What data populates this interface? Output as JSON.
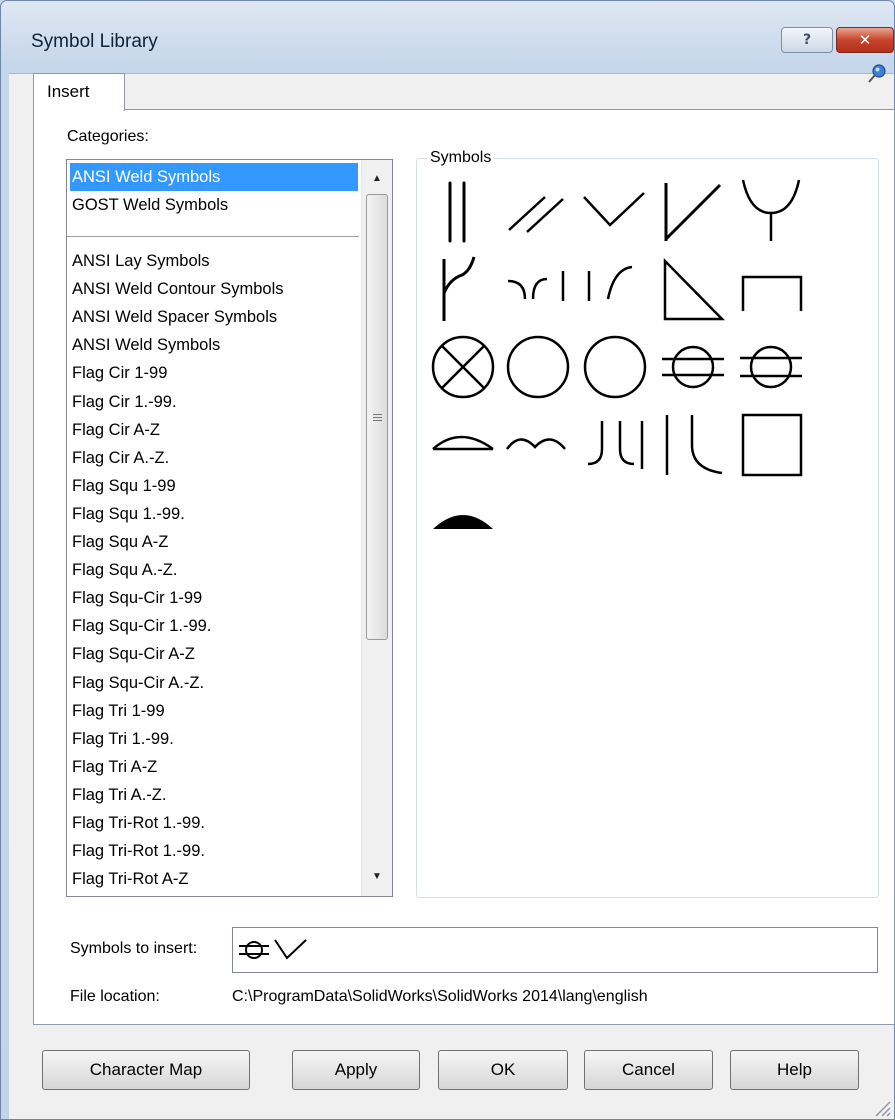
{
  "window": {
    "title": "Symbol Library",
    "help_glyph": "?",
    "close_glyph": "✕"
  },
  "tabs": [
    {
      "label": "Insert",
      "active": true
    }
  ],
  "categories": {
    "label": "Categories:",
    "top_items": [
      {
        "label": "ANSI Weld Symbols",
        "selected": true
      },
      {
        "label": "GOST Weld Symbols",
        "selected": false
      }
    ],
    "items": [
      "ANSI Lay Symbols",
      "ANSI Weld Contour Symbols",
      "ANSI Weld Spacer Symbols",
      "ANSI Weld Symbols",
      "Flag Cir 1-99",
      "Flag Cir 1.-99.",
      "Flag Cir A-Z",
      "Flag Cir A.-Z.",
      "Flag Squ 1-99",
      "Flag Squ 1.-99.",
      "Flag Squ A-Z",
      "Flag Squ A.-Z.",
      "Flag Squ-Cir 1-99",
      "Flag Squ-Cir 1.-99.",
      "Flag Squ-Cir A-Z",
      "Flag Squ-Cir A.-Z.",
      "Flag Tri 1-99",
      "Flag Tri 1.-99.",
      "Flag Tri A-Z",
      "Flag Tri A.-Z.",
      "Flag Tri-Rot 1.-99.",
      "Flag Tri-Rot 1.-99.",
      "Flag Tri-Rot A-Z"
    ],
    "scroll_up_glyph": "▲",
    "scroll_down_glyph": "▼"
  },
  "symbols": {
    "label": "Symbols",
    "icons": [
      "double-vertical-line-icon",
      "double-diagonal-line-icon",
      "v-groove-icon",
      "bevel-groove-icon",
      "y-groove-icon",
      "j-groove-icon",
      "flare-v-icon",
      "flare-bevel-icon",
      "fillet-triangle-icon",
      "square-bracket-icon",
      "circle-cross-icon",
      "circle-icon",
      "circle-large-icon",
      "circle-double-line-icon",
      "circle-line-icon",
      "convex-contour-icon",
      "double-arc-icon",
      "u-groove-icon",
      "j-groove-edge-icon",
      "square-icon",
      "filled-dome-icon"
    ]
  },
  "symbols_to_insert": {
    "label": "Symbols to insert:",
    "icons": [
      "circle-double-line-icon",
      "v-groove-icon"
    ]
  },
  "file_location": {
    "label": "File location:",
    "value": "C:\\ProgramData\\SolidWorks\\SolidWorks 2014\\lang\\english"
  },
  "buttons": {
    "character_map": "Character Map",
    "apply": "Apply",
    "ok": "OK",
    "cancel": "Cancel",
    "help": "Help"
  }
}
